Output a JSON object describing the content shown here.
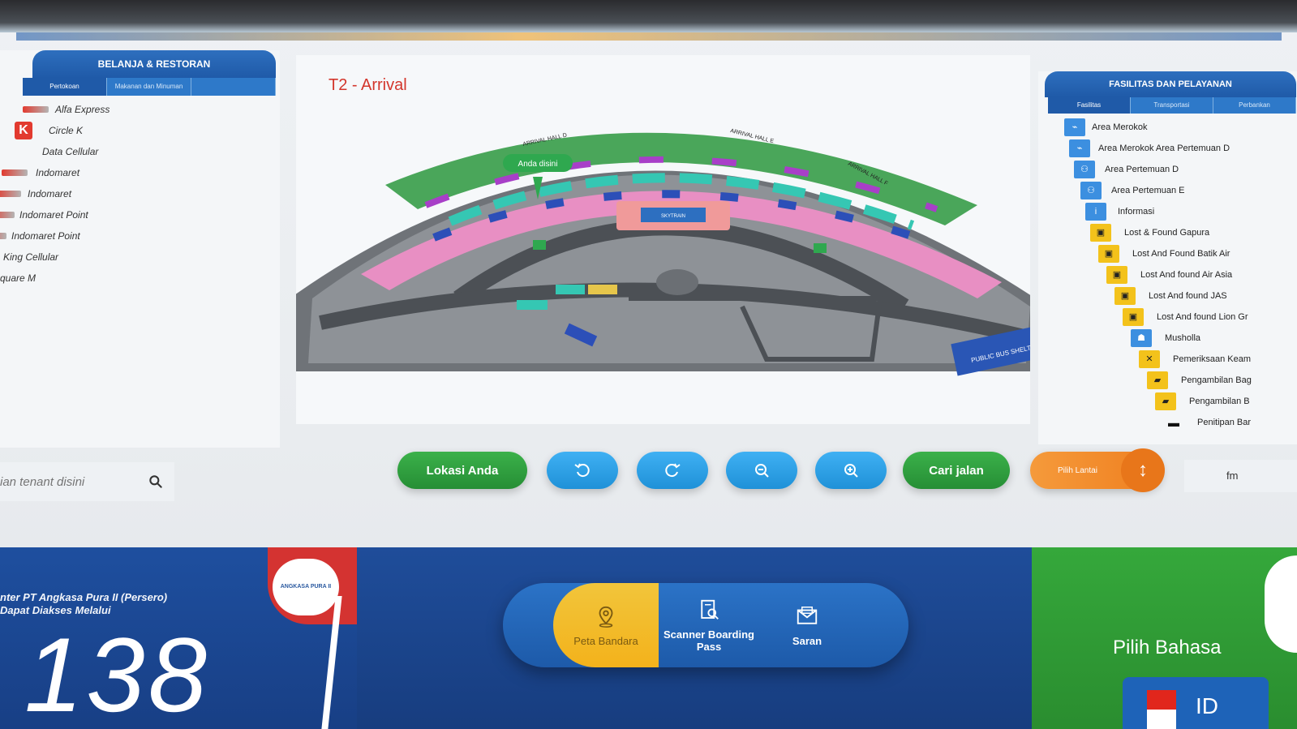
{
  "left_panel": {
    "title": "BELANJA & RESTORAN",
    "tabs": [
      "Pertokoan",
      "Makanan dan Minuman",
      ""
    ],
    "tenants": [
      {
        "name": "Alfa Express",
        "logo": "alfa-logo"
      },
      {
        "name": "Circle K",
        "logo": "circlek-logo"
      },
      {
        "name": "Data Cellular",
        "logo": ""
      },
      {
        "name": "Indomaret",
        "logo": "indomaret-logo"
      },
      {
        "name": "Indomaret",
        "logo": "indomaret-logo"
      },
      {
        "name": "Indomaret Point",
        "logo": "indomaret-logo"
      },
      {
        "name": "Indomaret Point",
        "logo": "indomaret-logo"
      },
      {
        "name": "King Cellular",
        "logo": ""
      },
      {
        "name": "quare M",
        "logo": ""
      }
    ],
    "search_placeholder": "ian tenant disini",
    "circlek_letter": "K"
  },
  "map": {
    "title": "T2 - Arrival",
    "you_are_here": "Anda disini",
    "labels": {
      "hall_d": "ARRIVAL HALL D",
      "hall_e": "ARRIVAL HALL E",
      "hall_f": "ARRIVAL HALL F",
      "skytrain": "SKYTRAIN",
      "bus_shelter": "PUBLIC BUS SHELTER"
    }
  },
  "right_panel": {
    "title": "FASILITAS DAN PELAYANAN",
    "tabs": [
      "Fasilitas",
      "Transportasi",
      "Perbankan"
    ],
    "facilities": [
      {
        "name": "Area Merokok",
        "icon": "smoking-icon",
        "style": "blue"
      },
      {
        "name": "Area Merokok Area Pertemuan D",
        "icon": "smoking-icon",
        "style": "blue"
      },
      {
        "name": "Area Pertemuan D",
        "icon": "meeting-icon",
        "style": "blue"
      },
      {
        "name": "Area Pertemuan E",
        "icon": "meeting-icon",
        "style": "blue"
      },
      {
        "name": "Informasi",
        "icon": "info-icon",
        "style": "blue"
      },
      {
        "name": "Lost & Found Gapura",
        "icon": "lost-found-icon",
        "style": "yellow"
      },
      {
        "name": "Lost And Found Batik Air",
        "icon": "lost-found-icon",
        "style": "yellow"
      },
      {
        "name": "Lost And found Air Asia",
        "icon": "lost-found-icon",
        "style": "yellow"
      },
      {
        "name": "Lost And found JAS",
        "icon": "lost-found-icon",
        "style": "yellow"
      },
      {
        "name": "Lost And found Lion Gr",
        "icon": "lost-found-icon",
        "style": "yellow"
      },
      {
        "name": "Musholla",
        "icon": "prayer-icon",
        "style": "blue"
      },
      {
        "name": "Pemeriksaan Keam",
        "icon": "security-icon",
        "style": "yellow"
      },
      {
        "name": "Pengambilan Bag",
        "icon": "baggage-icon",
        "style": "yellow"
      },
      {
        "name": "Pengambilan B",
        "icon": "baggage-icon",
        "style": "yellow"
      },
      {
        "name": "Penitipan Bar",
        "icon": "locker-icon",
        "style": "black"
      }
    ]
  },
  "controls": {
    "my_location": "Lokasi Anda",
    "find_route": "Cari jalan",
    "pick_floor": "Pilih Lantai",
    "floor_arrow": "↕",
    "fm_label": "fm"
  },
  "bottom": {
    "callcenter_line1": "nter PT Angkasa Pura II (Persero)",
    "callcenter_line2": "Dapat Diakses Melalui",
    "callcenter_number": "138",
    "logo_text": "ANGKASA PURA II",
    "menu": [
      {
        "label": "Peta Bandara",
        "icon": "map-pin-icon"
      },
      {
        "label": "Scanner Boarding Pass",
        "icon": "scanner-icon"
      },
      {
        "label": "Saran",
        "icon": "mail-icon"
      }
    ],
    "language_title": "Pilih Bahasa",
    "language_code": "ID"
  },
  "colors": {
    "brand_blue": "#1f5aa8",
    "button_green": "#2f9e3e",
    "button_blue": "#2aa0e8",
    "button_orange": "#f08a2a",
    "accent_yellow": "#f3c21b",
    "title_red": "#d3362c"
  }
}
